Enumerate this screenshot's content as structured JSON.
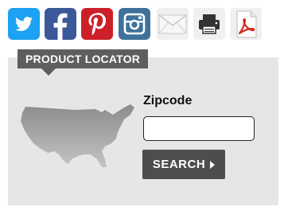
{
  "share": {
    "items": [
      {
        "icon": "twitter-icon",
        "color": "#1da1f2"
      },
      {
        "icon": "facebook-icon",
        "color": "#3b5998"
      },
      {
        "icon": "pinterest-icon",
        "color": "#cb2027"
      },
      {
        "icon": "instagram-icon",
        "color": "#3f729b"
      },
      {
        "icon": "email-icon",
        "color": "#e8e8e8"
      },
      {
        "icon": "print-icon",
        "color": "#333333"
      },
      {
        "icon": "pdf-icon",
        "color": "#d8281d"
      }
    ]
  },
  "locator": {
    "tab_label": "PRODUCT LOCATOR",
    "zip_label": "Zipcode",
    "zip_value": "",
    "search_label": "SEARCH",
    "colors": {
      "tab": "#5e5e5e",
      "panel": "#e6e6e6",
      "button": "#4d4d4d"
    }
  }
}
